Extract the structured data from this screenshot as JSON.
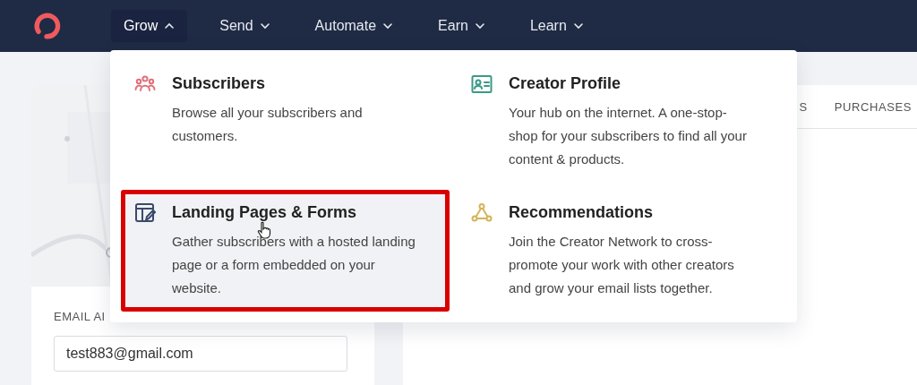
{
  "nav": {
    "items": [
      {
        "label": "Grow",
        "selected": true,
        "expanded": true
      },
      {
        "label": "Send",
        "selected": false,
        "expanded": false
      },
      {
        "label": "Automate",
        "selected": false,
        "expanded": false
      },
      {
        "label": "Earn",
        "selected": false,
        "expanded": false
      },
      {
        "label": "Learn",
        "selected": false,
        "expanded": false
      }
    ]
  },
  "profile_card": {
    "email_label": "EMAIL AI",
    "email_value": "test883@gmail.com"
  },
  "tabs": [
    {
      "label": "S",
      "selected": false
    },
    {
      "label": "PURCHASES",
      "selected": false
    }
  ],
  "dropdown": {
    "items": [
      {
        "kind": "people",
        "color": "#e0707a",
        "title": "Subscribers",
        "description": "Browse all your subscribers and customers.",
        "hovered": false,
        "annotated": false
      },
      {
        "kind": "card",
        "color": "#3a9a86",
        "title": "Creator Profile",
        "description": "Your hub on the internet. A one-stop-shop for your subscribers to find all your content & products.",
        "hovered": false,
        "annotated": false
      },
      {
        "kind": "form",
        "color": "#3b4a6b",
        "title": "Landing Pages & Forms",
        "description": "Gather subscribers with a hosted landing page or a form embedded on your website.",
        "hovered": true,
        "annotated": true
      },
      {
        "kind": "network",
        "color": "#d4b45a",
        "title": "Recommendations",
        "description": "Join the Creator Network to cross-promote your work with other creators and grow your email lists together.",
        "hovered": false,
        "annotated": false
      }
    ]
  }
}
